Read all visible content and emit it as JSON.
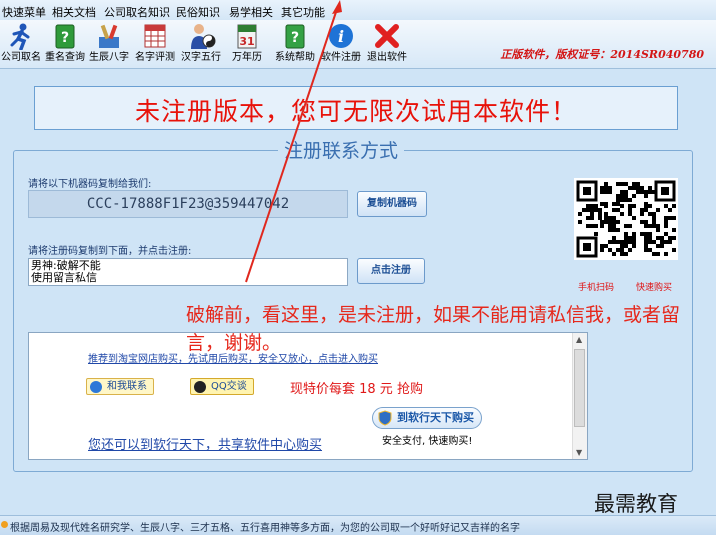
{
  "menu": [
    "快速菜单",
    "相关文档",
    "公司取名知识",
    "民俗知识",
    "易学相关",
    "其它功能"
  ],
  "toolbar": {
    "buttons": [
      {
        "label": "公司取名",
        "icon": "runner-icon"
      },
      {
        "label": "重名查询",
        "icon": "green-book-question-icon"
      },
      {
        "label": "生辰八字",
        "icon": "tools-icon"
      },
      {
        "label": "名字评测",
        "icon": "calendar-grid-icon"
      },
      {
        "label": "汉字五行",
        "icon": "person-bagua-icon"
      },
      {
        "label": "万年历",
        "icon": "calendar-page-icon"
      },
      {
        "label": "系统帮助",
        "icon": "green-help-book-icon"
      },
      {
        "label": "软件注册",
        "icon": "info-icon"
      },
      {
        "label": "退出软件",
        "icon": "red-x-icon"
      }
    ],
    "slogan": "正版软件，版权证号：2014SR040780"
  },
  "banner": "未注册版本，您可无限次试用本软件！",
  "group_title": "注册联系方式",
  "machine": {
    "label": "请将以下机器码复制给我们:",
    "code": "CCC-17888F1F23@359447042",
    "copy_button": "复制机器码"
  },
  "register": {
    "label": "请将注册码复制到下面，并点击注册:",
    "value": "男神:破解不能\n使用留言私信",
    "button": "点击注册"
  },
  "qr": {
    "left_label": "手机扫码",
    "right_label": "快速购买"
  },
  "panel": {
    "recommend": "推荐到淘宝网店购买，先试用后购买，安全又放心，点击进入购买",
    "contact_button": "和我联系",
    "qq_button": "QQ交谈",
    "price": "现特价每套 18 元 抢购",
    "buy_button": "到软行天下购买",
    "buy_sub": "安全支付, 快速购买!",
    "alt_link": "您还可以到软行天下，共享软件中心购买"
  },
  "notice": "破解前，看这里，是未注册，如果不能用请私信我，或者留言，谢谢。",
  "brand": "最需教育",
  "status": "根据周易及现代姓名研究学、生辰八字、三才五格、五行喜用神等多方面，为您的公司取一个好听好记又吉祥的名字",
  "colors": {
    "accent": "#e8120a",
    "frame": "#7eaad4",
    "background": "#cfe4f6"
  }
}
